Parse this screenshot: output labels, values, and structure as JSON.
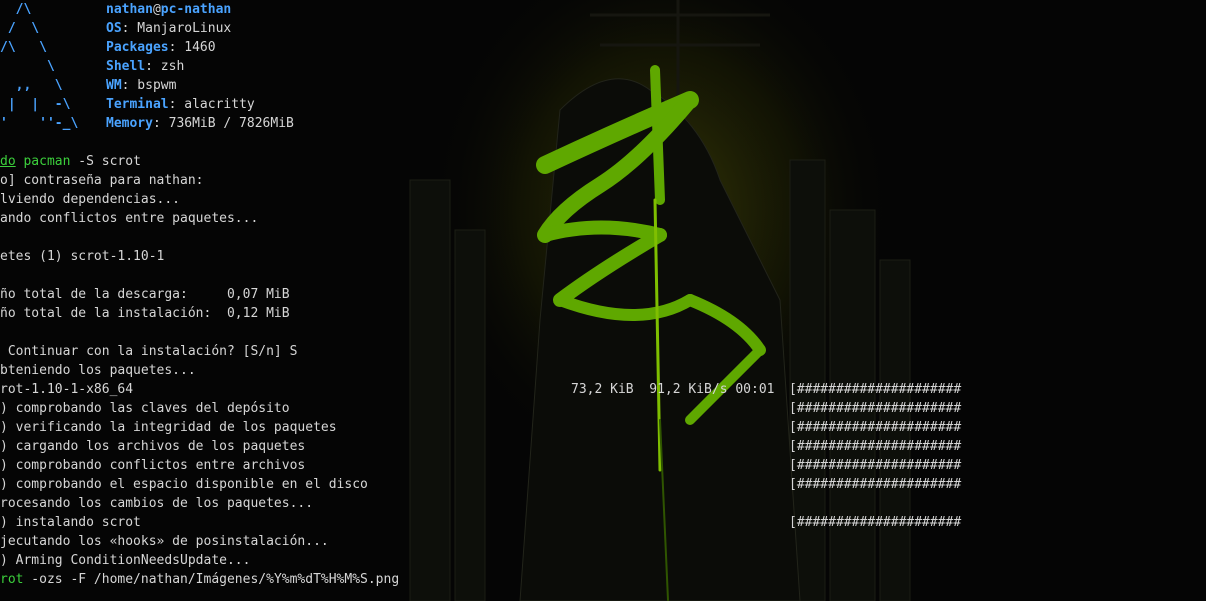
{
  "fetch": {
    "logo_lines": [
      "  /\\",
      " /  \\",
      "/\\   \\",
      "      \\",
      "  ,,   \\",
      " |  |  -\\",
      "'    ''-_\\"
    ],
    "user": "nathan",
    "at": "@",
    "host": "pc-nathan",
    "os_key": "OS",
    "os_val": ": ManjaroLinux",
    "pkg_key": "Packages",
    "pkg_val": ": 1460",
    "shell_key": "Shell",
    "shell_val": ": zsh",
    "wm_key": "WM",
    "wm_val": ": bspwm",
    "term_key": "Terminal",
    "term_val": ": alacritty",
    "mem_key": "Memory",
    "mem_val": ": 736MiB / 7826MiB"
  },
  "cmd1": {
    "a": "do",
    "b": " ",
    "c": "pacman",
    "d": " -S scrot"
  },
  "lines": {
    "l1": "o] contraseña para nathan:",
    "l2": "lviendo dependencias...",
    "l3": "ando conflictos entre paquetes...",
    "l4": "etes (1) scrot-1.10-1",
    "l5": "ño total de la descarga:     0,07 MiB",
    "l6": "ño total de la instalación:  0,12 MiB",
    "l7": " Continuar con la instalación? [S/n] S",
    "l8": "bteniendo los paquetes...",
    "l9": "rot-1.10-1-x86_64",
    "l10": ") comprobando las claves del depósito",
    "l11": ") verificando la integridad de los paquetes",
    "l12": ") cargando los archivos de los paquetes",
    "l13": ") comprobando conflictos entre archivos",
    "l14": ") comprobando el espacio disponible en el disco",
    "l15": "rocesando los cambios de los paquetes...",
    "l16": ") instalando scrot",
    "l17": "jecutando los «hooks» de posinstalación...",
    "l18": ") Arming ConditionNeedsUpdate..."
  },
  "download_stats": "73,2 KiB  91,2 KiB/s 00:01",
  "progress_bar": "[#####################",
  "progress_bar_short": "[####################",
  "cmd2": {
    "a": "rot",
    "b": " -ozs -F /home/nathan/Imágenes/%Y%m%dT%H%M%S.png"
  },
  "colors": {
    "accent_blue": "#4aa3ff",
    "cmd_green": "#3cd03c",
    "glyph_green": "#5fa800"
  }
}
